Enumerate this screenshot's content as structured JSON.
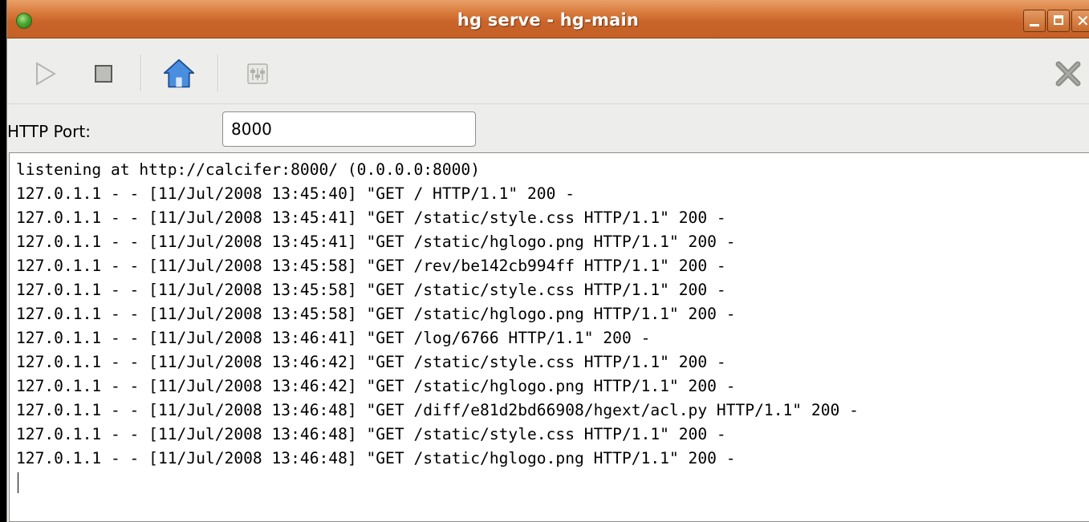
{
  "window": {
    "title": "hg serve - hg-main"
  },
  "toolbar": {
    "buttons": [
      {
        "name": "start-server",
        "icon": "play-icon"
      },
      {
        "name": "stop-server",
        "icon": "stop-icon"
      },
      {
        "name": "open-browser",
        "icon": "home-icon"
      },
      {
        "name": "settings",
        "icon": "settings-icon"
      },
      {
        "name": "close-tab",
        "icon": "close-icon"
      }
    ]
  },
  "port": {
    "label": "HTTP Port:",
    "value": "8000"
  },
  "log": {
    "lines": [
      "listening at http://calcifer:8000/ (0.0.0.0:8000)",
      "127.0.1.1 - - [11/Jul/2008 13:45:40] \"GET / HTTP/1.1\" 200 -",
      "127.0.1.1 - - [11/Jul/2008 13:45:41] \"GET /static/style.css HTTP/1.1\" 200 -",
      "127.0.1.1 - - [11/Jul/2008 13:45:41] \"GET /static/hglogo.png HTTP/1.1\" 200 -",
      "127.0.1.1 - - [11/Jul/2008 13:45:58] \"GET /rev/be142cb994ff HTTP/1.1\" 200 -",
      "127.0.1.1 - - [11/Jul/2008 13:45:58] \"GET /static/style.css HTTP/1.1\" 200 -",
      "127.0.1.1 - - [11/Jul/2008 13:45:58] \"GET /static/hglogo.png HTTP/1.1\" 200 -",
      "127.0.1.1 - - [11/Jul/2008 13:46:41] \"GET /log/6766 HTTP/1.1\" 200 -",
      "127.0.1.1 - - [11/Jul/2008 13:46:42] \"GET /static/style.css HTTP/1.1\" 200 -",
      "127.0.1.1 - - [11/Jul/2008 13:46:42] \"GET /static/hglogo.png HTTP/1.1\" 200 -",
      "127.0.1.1 - - [11/Jul/2008 13:46:48] \"GET /diff/e81d2bd66908/hgext/acl.py HTTP/1.1\" 200 -",
      "127.0.1.1 - - [11/Jul/2008 13:46:48] \"GET /static/style.css HTTP/1.1\" 200 -",
      "127.0.1.1 - - [11/Jul/2008 13:46:48] \"GET /static/hglogo.png HTTP/1.1\" 200 -"
    ]
  },
  "colors": {
    "titlebar": "#d7793a",
    "window_bg": "#ededeb",
    "home_icon": "#3a7bc8"
  }
}
